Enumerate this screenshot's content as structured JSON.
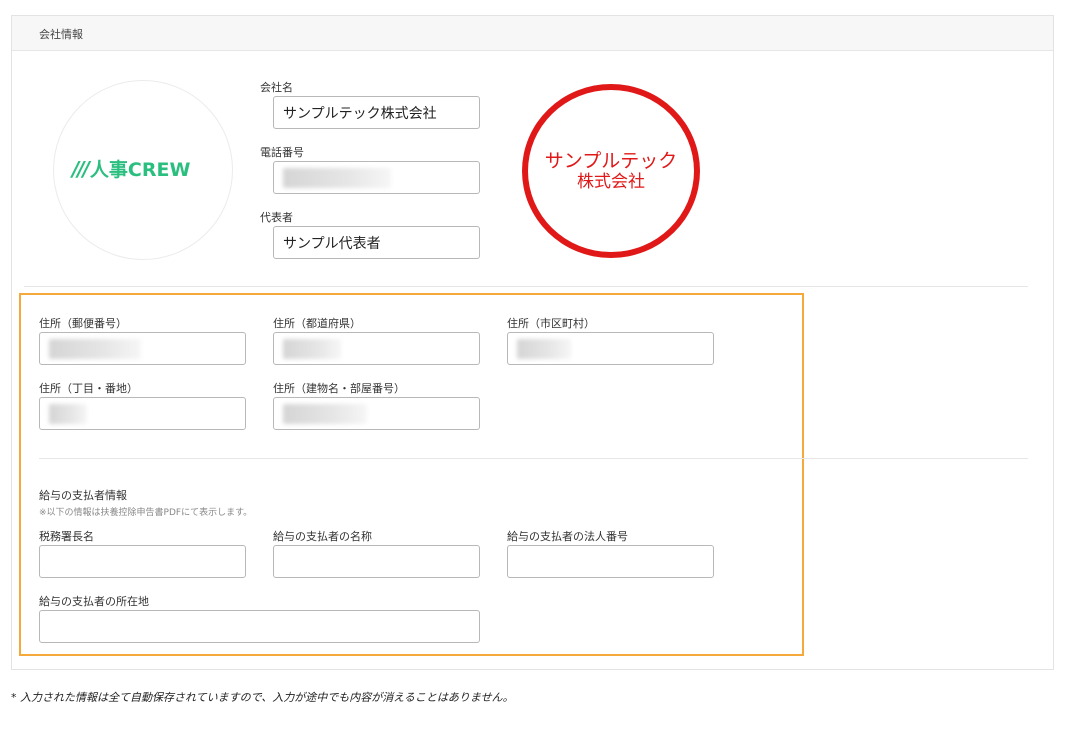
{
  "panel": {
    "title": "会社情報"
  },
  "logo": {
    "mark": "///",
    "text": "人事CREW"
  },
  "company": {
    "name_label": "会社名",
    "name_value": "サンプルテック株式会社",
    "phone_label": "電話番号",
    "rep_label": "代表者",
    "rep_value": "サンプル代表者"
  },
  "seal": {
    "line1": "サンプルテック",
    "line2": "株式会社"
  },
  "address": {
    "postal_label": "住所（郵便番号）",
    "prefecture_label": "住所（都道府県）",
    "city_label": "住所（市区町村）",
    "street_label": "住所（丁目・番地）",
    "building_label": "住所（建物名・部屋番号）"
  },
  "payer": {
    "section_title": "給与の支払者情報",
    "note": "※以下の情報は扶養控除申告書PDFにて表示します。",
    "tax_office_label": "税務署長名",
    "payer_name_label": "給与の支払者の名称",
    "corp_number_label": "給与の支払者の法人番号",
    "payer_address_label": "給与の支払者の所在地"
  },
  "footer": {
    "note": "* 入力された情報は全て自動保存されていますので、入力が途中でも内容が消えることはありません。"
  },
  "colors": {
    "accent_green": "#2bbf7f",
    "seal_red": "#e01818",
    "highlight_orange": "#f4a93a"
  }
}
